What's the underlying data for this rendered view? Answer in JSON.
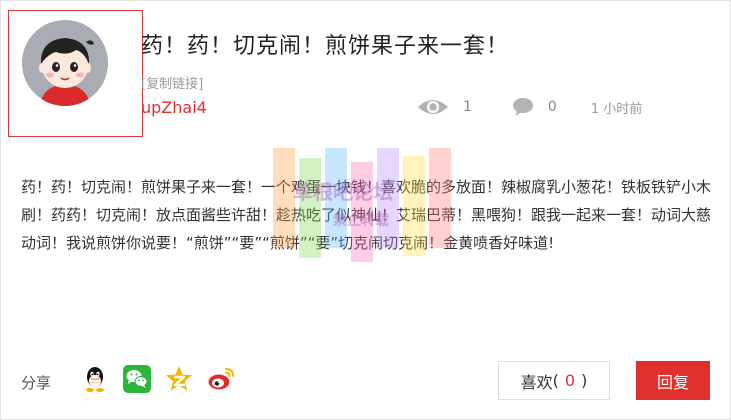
{
  "post": {
    "title": "药！药！切克闹！煎饼果子来一套！",
    "copy_link": "[复制链接]",
    "username": "upZhai4",
    "views": "1",
    "comments": "0",
    "time_ago": "1 小时前",
    "body": "药！药！切克闹！煎饼果子来一套！一个鸡蛋一块钱！喜欢脆的多放面！辣椒腐乳小葱花！铁板铁铲小木刷！药药！切克闹！放点面酱些许甜！趁热吃了似神仙！艾瑞巴蒂！黑喂狗！跟我一起来一套！动词大慈动词！我说煎饼你说要！“煎饼”“要”“煎饼”“要”切克闹切克闹！金黄喷香好味道!"
  },
  "watermark": {
    "title": "草根吧论坛",
    "subtitle": "禁止转载"
  },
  "share": {
    "label": "分享",
    "icons": [
      "qq-icon",
      "wechat-icon",
      "qzone-icon",
      "weibo-icon"
    ]
  },
  "actions": {
    "like_label": "喜欢",
    "like_open": "(",
    "like_count": "0",
    "like_close": ")",
    "reply_label": "回复"
  },
  "colors": {
    "accent": "#e0302e",
    "avatar_bg": "#a9acb3",
    "muted": "#999999"
  }
}
